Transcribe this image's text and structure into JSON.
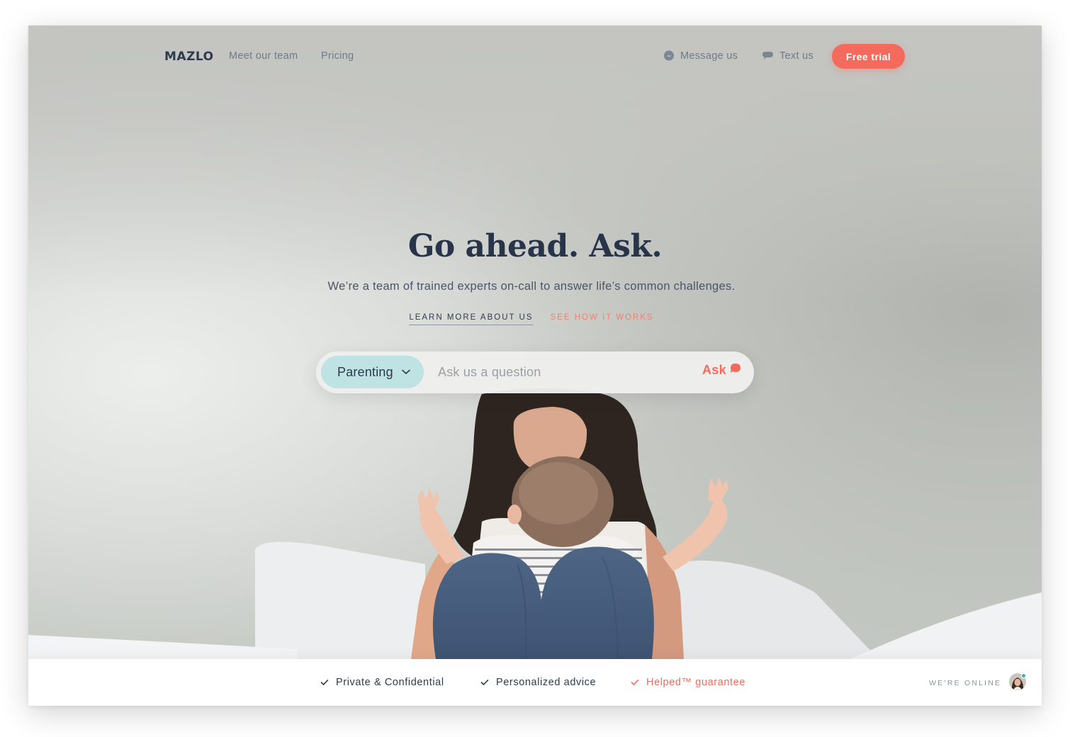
{
  "brand": {
    "logo_text": "MAZLO",
    "accent_color": "#f46a5c",
    "topic_color": "#bfe2e3",
    "text_dark": "#27344a"
  },
  "nav": {
    "links": [
      {
        "label": "Meet our team"
      },
      {
        "label": "Pricing"
      }
    ],
    "message_us": {
      "label": "Message us",
      "icon": "messenger-icon"
    },
    "text_us": {
      "label": "Text us",
      "icon": "chat-bubble-icon"
    },
    "free_trial": {
      "label": "Free trial"
    }
  },
  "hero": {
    "title": "Go ahead. Ask.",
    "subtitle": "We’re a team of trained experts on-call to answer life’s common challenges.",
    "links": {
      "learn_more": "LEARN MORE ABOUT US",
      "how_it_works": "SEE HOW IT WORKS"
    }
  },
  "search": {
    "topic": "Parenting",
    "topic_icon": "chevron-down-icon",
    "placeholder": "Ask us a question",
    "value": "",
    "ask_label": "Ask",
    "ask_icon": "speech-bubble-icon"
  },
  "footer_bar": {
    "features": [
      {
        "label": "Private & Confidential",
        "icon": "check-icon"
      },
      {
        "label": "Personalized advice",
        "icon": "check-icon"
      },
      {
        "label": "Helped™ guarantee",
        "icon": "check-icon",
        "accent": true
      }
    ],
    "online_label": "WE’RE ONLINE",
    "online_icon": "avatar-online"
  }
}
